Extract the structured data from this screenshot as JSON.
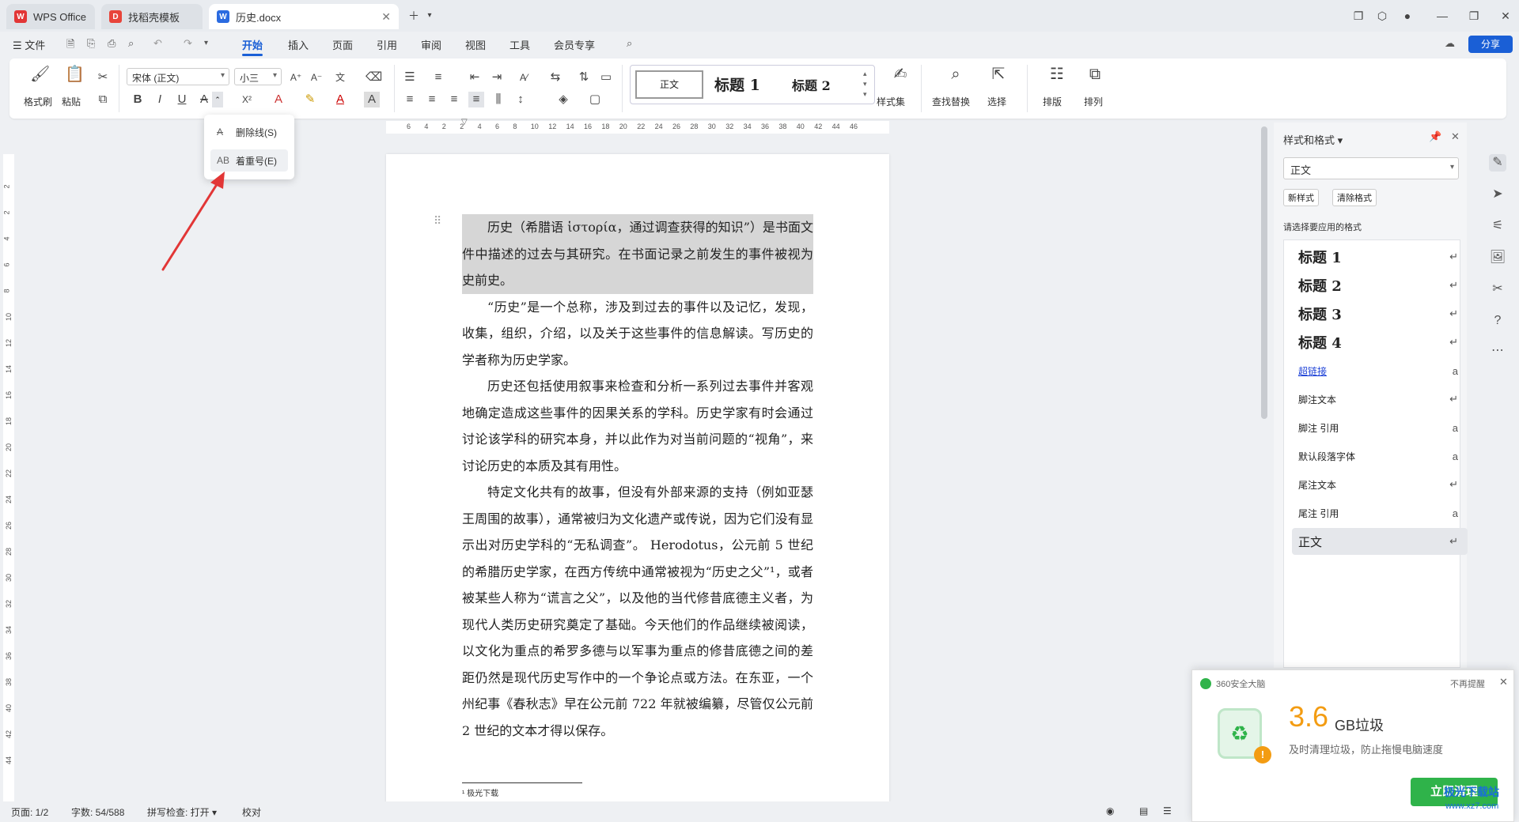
{
  "tabs": [
    {
      "label": "WPS Office",
      "icon": "wps-logo-icon"
    },
    {
      "label": "找稻壳模板",
      "icon": "docer-icon"
    },
    {
      "label": "历史.docx",
      "icon": "word-doc-icon"
    }
  ],
  "menu": {
    "file": "文件",
    "items": [
      "开始",
      "插入",
      "页面",
      "引用",
      "审阅",
      "视图",
      "工具",
      "会员专享"
    ],
    "active": "开始",
    "share": "分享"
  },
  "ribbon": {
    "format_painter": "格式刷",
    "paste": "粘贴",
    "font_name": "宋体 (正文)",
    "font_size": "小三",
    "style_normal": "正文",
    "style_h1": "标题 1",
    "style_h2": "标题 2",
    "style_set": "样式集",
    "find_replace": "查找替换",
    "select": "选择",
    "layout": "排版",
    "arrange": "排列"
  },
  "popup": {
    "strikethrough": "删除线(S)",
    "emphasis": "着重号(E)"
  },
  "ruler": {
    "h_ticks": [
      "6",
      "4",
      "2",
      "2",
      "4",
      "6",
      "8",
      "10",
      "12",
      "14",
      "16",
      "18",
      "20",
      "22",
      "24",
      "26",
      "28",
      "30",
      "32",
      "34",
      "36",
      "38",
      "40",
      "42",
      "44",
      "46"
    ],
    "v_ticks": [
      "2",
      "2",
      "4",
      "6",
      "8",
      "10",
      "12",
      "14",
      "16",
      "18",
      "20",
      "22",
      "24",
      "26",
      "28",
      "30",
      "32",
      "34",
      "36",
      "38",
      "40",
      "42",
      "44"
    ]
  },
  "document": {
    "paragraphs": [
      "历史（希腊语 ἱστορία，通过调查获得的知识”）是书面文件中描述的过去与其研究。在书面记录之前发生的事件被视为史前史。",
      "“历史”是一个总称，涉及到过去的事件以及记忆，发现，收集，组织，介绍，以及关于这些事件的信息解读。写历史的学者称为历史学家。",
      "历史还包括使用叙事来检查和分析一系列过去事件并客观地确定造成这些事件的因果关系的学科。历史学家有时会通过讨论该学科的研究本身，并以此作为对当前问题的“视角”，来讨论历史的本质及其有用性。",
      "特定文化共有的故事，但没有外部来源的支持（例如亚瑟王周围的故事），通常被归为文化遗产或传说，因为它们没有显示出对历史学科的“无私调查”。 Herodotus，公元前 5 世纪的希腊历史学家，在西方传统中通常被视为“历史之父”¹，或者被某些人称为“谎言之父”，以及他的当代修昔底德主义者，为现代人类历史研究奠定了基础。今天他们的作品继续被阅读，以文化为重点的希罗多德与以军事为重点的修昔底德之间的差距仍然是现代历史写作中的一个争论点或方法。在东亚，一个州纪事《春秋志》早在公元前 722 年就被编纂，尽管仅公元前 2 世纪的文本才得以保存。"
    ],
    "footnote": "¹ 极光下载"
  },
  "panel": {
    "title": "样式和格式",
    "current_style": "正文",
    "new_style": "新样式",
    "clear_format": "清除格式",
    "prompt": "请选择要应用的格式",
    "styles": [
      {
        "label": "标题  1",
        "kind": "h"
      },
      {
        "label": "标题  2",
        "kind": "h"
      },
      {
        "label": "标题  3",
        "kind": "h"
      },
      {
        "label": "标题 4",
        "kind": "h"
      },
      {
        "label": "超链接",
        "kind": "link"
      },
      {
        "label": "脚注文本",
        "kind": "p"
      },
      {
        "label": "脚注 引用",
        "kind": "c"
      },
      {
        "label": "默认段落字体",
        "kind": "c"
      },
      {
        "label": "尾注文本",
        "kind": "p"
      },
      {
        "label": "尾注 引用",
        "kind": "c"
      },
      {
        "label": "正文",
        "kind": "p"
      }
    ]
  },
  "status": {
    "page": "页面: 1/2",
    "words": "字数: 54/588",
    "spell": "拼写检查: 打开",
    "proof": "校对"
  },
  "toast": {
    "app": "360安全大脑",
    "dismiss": "不再提醒",
    "size": "3.6",
    "unit": "GB垃圾",
    "desc": "及时清理垃圾，防止拖慢电脑速度",
    "button": "立即清理",
    "watermark": "极光下载站",
    "watermark_url": "www.xz7.com"
  },
  "colors": {
    "accent": "#1a5fd6",
    "toast_green": "#2fb34a",
    "size_orange": "#f39c12",
    "arrow_red": "#e23636"
  }
}
